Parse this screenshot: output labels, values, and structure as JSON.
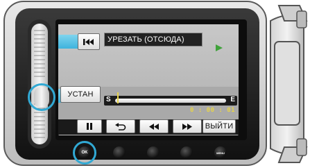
{
  "screen": {
    "prev_icon": "skip-back-icon",
    "title": "УРЕЗАТЬ (ОТСЮДА)",
    "play_icon": "play-icon",
    "set_label": "УСТАН",
    "timeline_start_label": "S",
    "timeline_end_label": "E",
    "timecode": "0 : 00 : 01",
    "timeline_position": 0.02
  },
  "controls": {
    "pause_icon": "pause-icon",
    "return_icon": "return-icon",
    "rewind_icon": "rewind-icon",
    "fastforward_icon": "fast-forward-icon",
    "exit_label": "ВЫЙТИ"
  },
  "buttons": {
    "ok_label": "OK",
    "menu_label": "MENU"
  },
  "colors": {
    "accent": "#31a9d4",
    "timecode": "#e7d44a",
    "play_green": "#3fa23a"
  }
}
